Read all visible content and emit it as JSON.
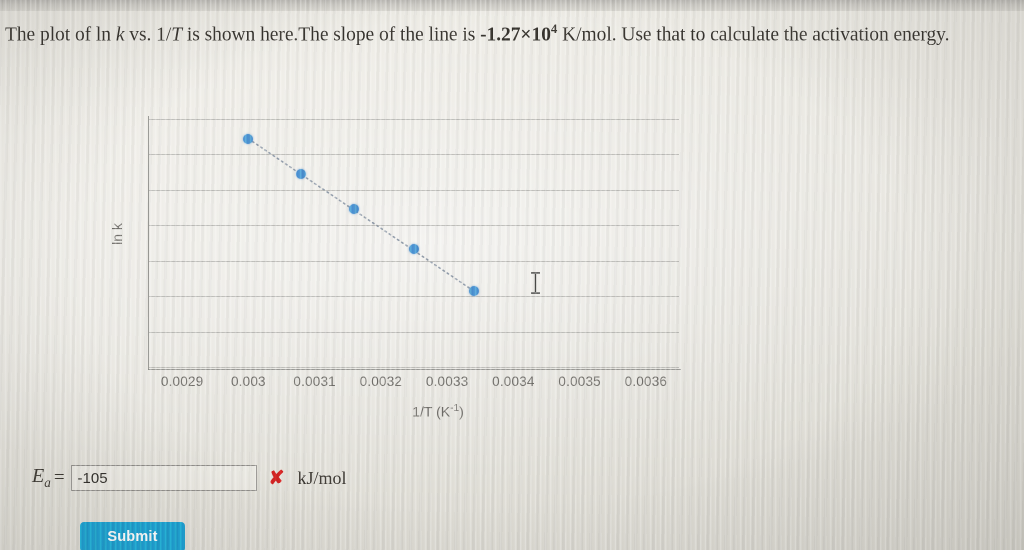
{
  "prompt": {
    "part1": "The plot of ln ",
    "var_k": "k",
    "part2": " vs. 1/",
    "var_T": "T",
    "part3": " is shown here.The slope of the line is ",
    "slope_mantissa": "-1.27×10",
    "slope_exponent": "4",
    "part4": " K/mol. Use that to calculate the activation energy."
  },
  "chart_data": {
    "type": "scatter",
    "title": "",
    "xlabel": "1/T (K⁻¹)",
    "ylabel": "ln k",
    "xlabel_base": "1/T (K",
    "xlabel_sup": "-1",
    "xlabel_close": ")",
    "xticks": [
      "0.0029",
      "0.003",
      "0.0031",
      "0.0032",
      "0.0033",
      "0.0034",
      "0.0035",
      "0.0036"
    ],
    "xtick_values": [
      0.0029,
      0.003,
      0.0031,
      0.0032,
      0.0033,
      0.0034,
      0.0035,
      0.0036
    ],
    "xlim": [
      0.00285,
      0.00365
    ],
    "ylim": [
      -10.2,
      -1.4
    ],
    "yticks_shown": false,
    "grid": "horizontal",
    "gridline_count": 8,
    "legend": "none",
    "series": [
      {
        "name": "ln k vs 1/T",
        "color": "#4a8ed0",
        "marker": "circle",
        "x": [
          0.003,
          0.00308,
          0.00316,
          0.00325,
          0.00334
        ],
        "y": [
          -2.1,
          -3.35,
          -4.6,
          -6.0,
          -7.5
        ]
      }
    ],
    "trendline": {
      "style": "dotted",
      "color": "#8f9aa8",
      "slope": -12700,
      "x_start": 0.003,
      "x_end": 0.00334
    }
  },
  "answer": {
    "label_base": "E",
    "label_sub": "a",
    "equals": "=",
    "value": "-105",
    "placeholder": "",
    "mark": "✘",
    "mark_color": "#cf2222",
    "unit": "kJ/mol"
  },
  "submit": {
    "label": "Submit"
  }
}
